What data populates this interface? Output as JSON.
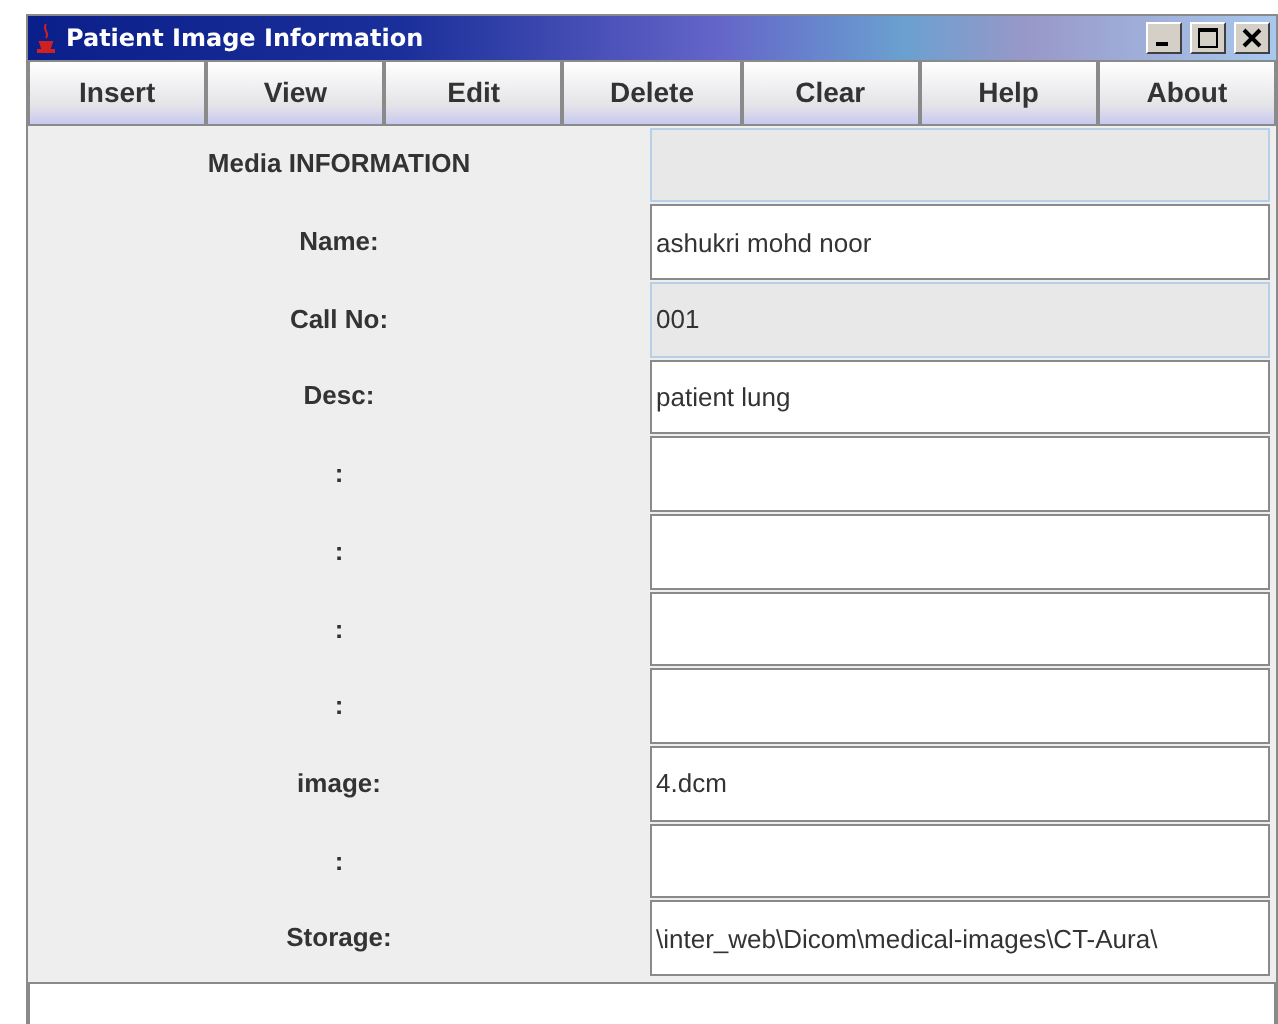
{
  "window": {
    "title": "Patient Image Information"
  },
  "toolbar": [
    "Insert",
    "View",
    "Edit",
    "Delete",
    "Clear",
    "Help",
    "About"
  ],
  "form": [
    {
      "label": "Media INFORMATION",
      "editable": false
    },
    {
      "label": "Name:",
      "value": "ashukri mohd noor",
      "editable": true
    },
    {
      "label": "Call No:",
      "value": "001",
      "editable": false
    },
    {
      "label": "Desc:",
      "value": "patient lung",
      "editable": true
    },
    {
      "label": ":",
      "editable": true
    },
    {
      "label": ":",
      "editable": true
    },
    {
      "label": ":",
      "editable": true
    },
    {
      "label": ":",
      "editable": true
    },
    {
      "label": "image:",
      "value": "4.dcm",
      "editable": true
    },
    {
      "label": ":",
      "editable": true
    },
    {
      "label": "Storage:",
      "value": "\\inter_web\\Dicom\\medical-images\\CT-Aura\\",
      "editable": true
    }
  ]
}
